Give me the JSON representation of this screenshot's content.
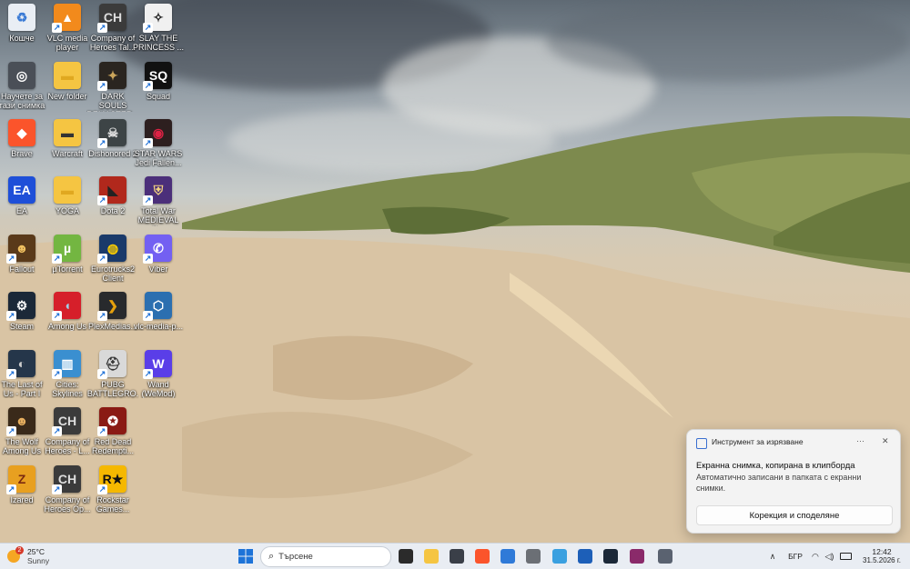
{
  "desktop_icons": [
    {
      "id": "recycle",
      "label": "Кошче",
      "col": 0,
      "row": 0,
      "color": "#e9eef4",
      "glyph": "♻",
      "glyph_color": "#3a7bd5",
      "shortcut": false
    },
    {
      "id": "vlc",
      "label": "VLC media player",
      "col": 1,
      "row": 0,
      "color": "#f28a1c",
      "glyph": "▲",
      "glyph_color": "#fff",
      "shortcut": true
    },
    {
      "id": "coh1",
      "label": "Company of Heroes Tal...",
      "col": 2,
      "row": 0,
      "color": "#3b3b3b",
      "glyph": "CH",
      "glyph_color": "#ddd",
      "shortcut": true
    },
    {
      "id": "slay",
      "label": "SLAY THE PRINCESS ...",
      "col": 3,
      "row": 0,
      "color": "#f0f0f0",
      "glyph": "✧",
      "glyph_color": "#222",
      "shortcut": true
    },
    {
      "id": "learn",
      "label": "Научете за тази снимка",
      "col": 0,
      "row": 1,
      "color": "#4a4f57",
      "glyph": "◎",
      "glyph_color": "#fff",
      "shortcut": false
    },
    {
      "id": "newfolder",
      "label": "New folder",
      "col": 1,
      "row": 1,
      "color": "#f5c542",
      "glyph": "▬",
      "glyph_color": "#e0a820",
      "shortcut": false
    },
    {
      "id": "darksouls",
      "label": "DARK SOULS REMASTER...",
      "col": 2,
      "row": 1,
      "color": "#2a2520",
      "glyph": "✦",
      "glyph_color": "#c9a45a",
      "shortcut": true
    },
    {
      "id": "squad",
      "label": "Squad",
      "col": 3,
      "row": 1,
      "color": "#111",
      "glyph": "SQ",
      "glyph_color": "#fff",
      "shortcut": true
    },
    {
      "id": "brave",
      "label": "Brave",
      "col": 0,
      "row": 2,
      "color": "#fb542b",
      "glyph": "◆",
      "glyph_color": "#fff",
      "shortcut": false
    },
    {
      "id": "warcraft",
      "label": "Warcraft",
      "col": 1,
      "row": 2,
      "color": "#f5c542",
      "glyph": "▬",
      "glyph_color": "#333",
      "shortcut": false
    },
    {
      "id": "dishonored",
      "label": "Dishonored 2",
      "col": 2,
      "row": 2,
      "color": "#3d4446",
      "glyph": "☠",
      "glyph_color": "#ddd",
      "shortcut": true
    },
    {
      "id": "starwars",
      "label": "STAR WARS Jedi Fallen...",
      "col": 3,
      "row": 2,
      "color": "#2d1f1f",
      "glyph": "◉",
      "glyph_color": "#d24",
      "shortcut": true
    },
    {
      "id": "ea",
      "label": "EA",
      "col": 0,
      "row": 3,
      "color": "#1e4fd8",
      "glyph": "EA",
      "glyph_color": "#fff",
      "shortcut": false
    },
    {
      "id": "yoga",
      "label": "YOGA",
      "col": 1,
      "row": 3,
      "color": "#f5c542",
      "glyph": "▬",
      "glyph_color": "#e0a820",
      "shortcut": false
    },
    {
      "id": "dota",
      "label": "Dota 2",
      "col": 2,
      "row": 3,
      "color": "#b1281c",
      "glyph": "◣",
      "glyph_color": "#222",
      "shortcut": true
    },
    {
      "id": "totalwar",
      "label": "Total War MEDIEVAL II...",
      "col": 3,
      "row": 3,
      "color": "#4b2f7a",
      "glyph": "⛨",
      "glyph_color": "#f0d080",
      "shortcut": true
    },
    {
      "id": "fallout",
      "label": "Fallout",
      "col": 0,
      "row": 4,
      "color": "#5a3a1a",
      "glyph": "☻",
      "glyph_color": "#f0c060",
      "shortcut": true
    },
    {
      "id": "utorrent",
      "label": "µTorrent",
      "col": 1,
      "row": 4,
      "color": "#73b641",
      "glyph": "µ",
      "glyph_color": "#fff",
      "shortcut": true
    },
    {
      "id": "eurotrucks",
      "label": "Eurotrucks2 Client",
      "col": 2,
      "row": 4,
      "color": "#1a3a6a",
      "glyph": "◍",
      "glyph_color": "#ffd000",
      "shortcut": true
    },
    {
      "id": "viber",
      "label": "Viber",
      "col": 3,
      "row": 4,
      "color": "#7360f2",
      "glyph": "✆",
      "glyph_color": "#fff",
      "shortcut": true
    },
    {
      "id": "steam",
      "label": "Steam",
      "col": 0,
      "row": 5,
      "color": "#1b2838",
      "glyph": "⚙",
      "glyph_color": "#fff",
      "shortcut": true
    },
    {
      "id": "amongus",
      "label": "Among Us",
      "col": 1,
      "row": 5,
      "color": "#d61f2a",
      "glyph": "◖",
      "glyph_color": "#9fd0e8",
      "shortcut": true
    },
    {
      "id": "plex",
      "label": "PlexMedias...",
      "col": 2,
      "row": 5,
      "color": "#282a2d",
      "glyph": "❯",
      "glyph_color": "#e5a00d",
      "shortcut": true
    },
    {
      "id": "vlcmedia",
      "label": "vlc-media-p...",
      "col": 3,
      "row": 5,
      "color": "#2b6fb0",
      "glyph": "⬡",
      "glyph_color": "#fff",
      "shortcut": true
    },
    {
      "id": "lastofus",
      "label": "The Last of Us - Part I",
      "col": 0,
      "row": 6,
      "color": "#25364a",
      "glyph": "◐",
      "glyph_color": "#ccc",
      "shortcut": true
    },
    {
      "id": "cities",
      "label": "Cities: Skylines",
      "col": 1,
      "row": 6,
      "color": "#3a8fd0",
      "glyph": "▥",
      "glyph_color": "#fff",
      "shortcut": true
    },
    {
      "id": "pubg",
      "label": "PUBG BATTLEGRO...",
      "col": 2,
      "row": 6,
      "color": "#d9d9d9",
      "glyph": "⛑",
      "glyph_color": "#333",
      "shortcut": true
    },
    {
      "id": "wand",
      "label": "Wand (WeMod)",
      "col": 3,
      "row": 6,
      "color": "#5a3ee8",
      "glyph": "W",
      "glyph_color": "#fff",
      "shortcut": true
    },
    {
      "id": "wolf",
      "label": "The Wolf Among Us",
      "col": 0,
      "row": 7,
      "color": "#3a2a1a",
      "glyph": "☻",
      "glyph_color": "#e8b060",
      "shortcut": true
    },
    {
      "id": "coh2",
      "label": "Company of Heroes - L...",
      "col": 1,
      "row": 7,
      "color": "#3b3b3b",
      "glyph": "CH",
      "glyph_color": "#ddd",
      "shortcut": true
    },
    {
      "id": "rdr",
      "label": "Red Dead Redempti...",
      "col": 2,
      "row": 7,
      "color": "#8a1a14",
      "glyph": "✪",
      "glyph_color": "#fff",
      "shortcut": true
    },
    {
      "id": "izared",
      "label": "Izared",
      "col": 0,
      "row": 8,
      "color": "#e8a020",
      "glyph": "Z",
      "glyph_color": "#7a2a10",
      "shortcut": true
    },
    {
      "id": "coh3",
      "label": "Company of Heroes Op...",
      "col": 1,
      "row": 8,
      "color": "#3b3b3b",
      "glyph": "CH",
      "glyph_color": "#ddd",
      "shortcut": true
    },
    {
      "id": "rockstar",
      "label": "Rockstar Games...",
      "col": 2,
      "row": 8,
      "color": "#f5b800",
      "glyph": "R★",
      "glyph_color": "#111",
      "shortcut": true
    }
  ],
  "notification": {
    "app_name": "Инструмент за изрязване",
    "more_label": "···",
    "close_label": "✕",
    "title": "Екранна снимка, копирана в клипборда",
    "body": "Автоматично записани в папката с екранни снимки.",
    "action_label": "Корекция и споделяне"
  },
  "taskbar": {
    "weather": {
      "temp": "25°C",
      "condition": "Sunny",
      "badge": "2"
    },
    "search_placeholder": "Търсене",
    "apps": [
      {
        "id": "taskview",
        "color": "#2b2b2b"
      },
      {
        "id": "explorer",
        "color": "#f5c542"
      },
      {
        "id": "hexapp",
        "color": "#3a3f48"
      },
      {
        "id": "brave",
        "color": "#fb542b"
      },
      {
        "id": "photos",
        "color": "#2f7ad8"
      },
      {
        "id": "calculator",
        "color": "#6b6f75"
      },
      {
        "id": "remote",
        "color": "#3aa0e0"
      },
      {
        "id": "mail",
        "color": "#1d5fb8"
      },
      {
        "id": "steam",
        "color": "#1b2838"
      },
      {
        "id": "winrar",
        "color": "#8a2a6a"
      },
      {
        "id": "settings",
        "color": "#5a6270"
      }
    ],
    "tray": {
      "chevron": "∧",
      "language": "БГР",
      "time": "12:42",
      "date": "31.5.2026 г."
    }
  }
}
